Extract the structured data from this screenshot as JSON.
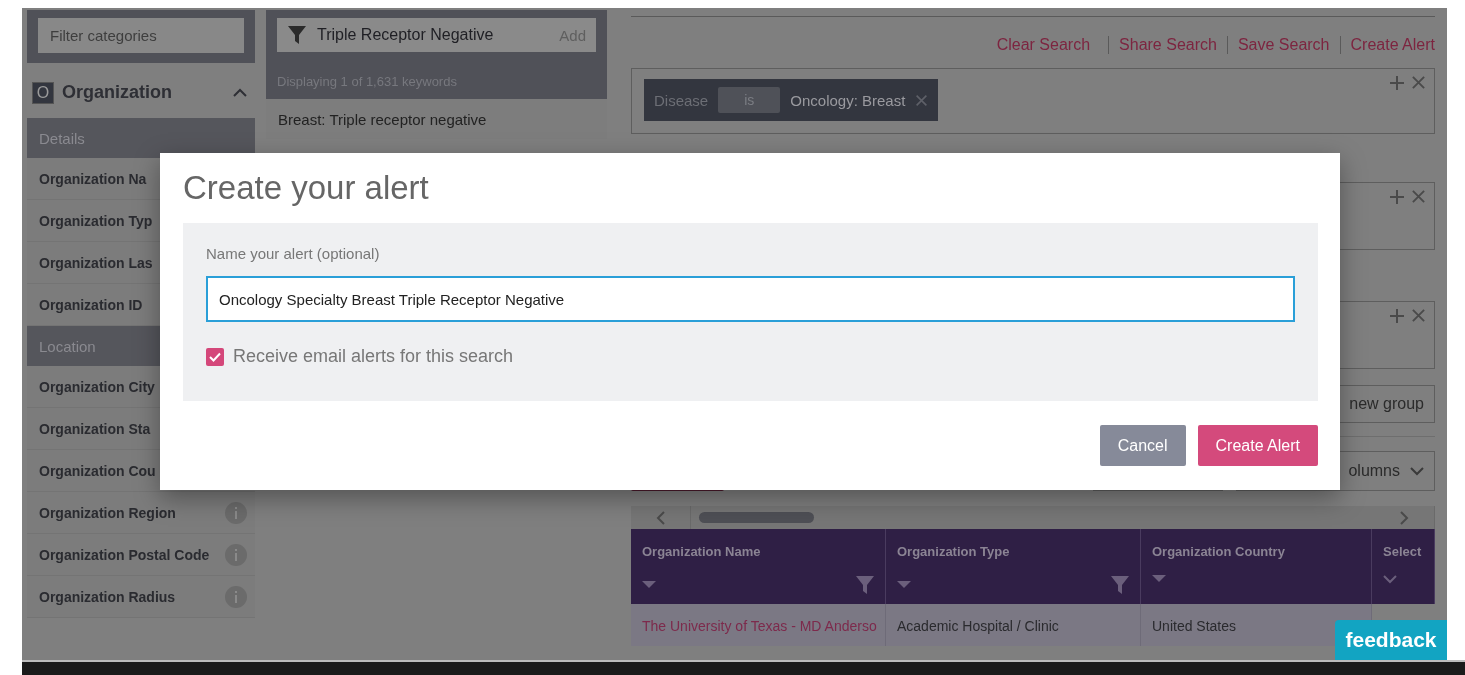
{
  "sidebar": {
    "filter_placeholder": "Filter categories",
    "category": {
      "badge": "O",
      "title": "Organization",
      "expanded": true
    },
    "sections": [
      {
        "title": "Details",
        "items": [
          {
            "label": "Organization Na"
          },
          {
            "label": "Organization Typ"
          },
          {
            "label": "Organization Las"
          },
          {
            "label": "Organization ID"
          }
        ]
      },
      {
        "title": "Location",
        "items": [
          {
            "label": "Organization City"
          },
          {
            "label": "Organization Sta"
          },
          {
            "label": "Organization Cou"
          },
          {
            "label": "Organization Region",
            "info": true
          },
          {
            "label": "Organization Postal Code",
            "info": true
          },
          {
            "label": "Organization Radius",
            "info": true
          }
        ]
      }
    ]
  },
  "keywords": {
    "query": "Triple Receptor Negative",
    "add": "Add",
    "count": "Displaying 1 of 1,631 keywords",
    "results": [
      "Breast: Triple receptor negative"
    ]
  },
  "search": {
    "actions": [
      "Clear Search",
      "Share Search",
      "Save Search",
      "Create Alert"
    ],
    "groups": [
      {
        "kind": "filter",
        "field": "Disease",
        "operator": "is",
        "value": "Oncology: Breast"
      },
      {
        "kind": "empty"
      },
      {
        "kind": "empty"
      }
    ],
    "new_group": "new group",
    "columns_menu": "olumns"
  },
  "table": {
    "columns": [
      {
        "title": "Organization Name",
        "filterable": true
      },
      {
        "title": "Organization Type",
        "filterable": true
      },
      {
        "title": "Organization Country",
        "filterable": false
      },
      {
        "title": "Select",
        "filterable": false
      }
    ],
    "rows": [
      {
        "cells": [
          "The University of Texas - MD Anderso",
          "Academic Hospital / Clinic",
          "United States"
        ]
      }
    ]
  },
  "modal": {
    "title": "Create your alert",
    "field_label": "Name your alert (optional)",
    "value": "Oncology Specialty Breast Triple Receptor Negative",
    "email_alerts": {
      "label": "Receive email alerts for this search",
      "checked": true
    },
    "buttons": [
      {
        "label": "Cancel",
        "kind": "secondary"
      },
      {
        "label": "Create Alert",
        "kind": "primary"
      }
    ]
  },
  "feedback": "feedback"
}
